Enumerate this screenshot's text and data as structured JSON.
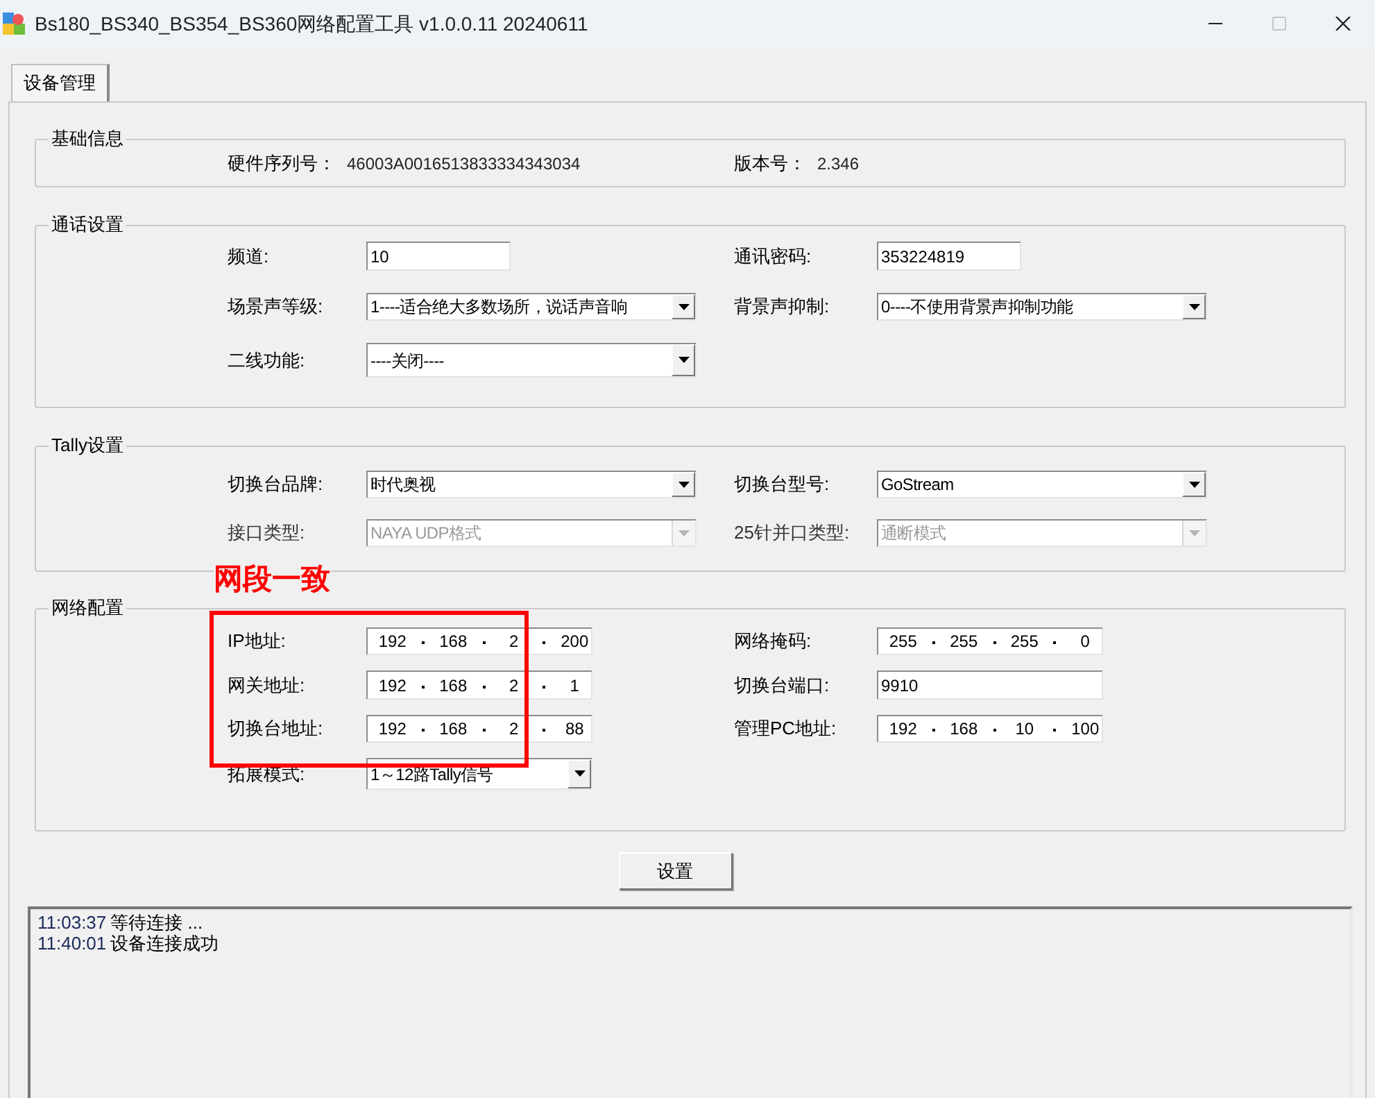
{
  "window": {
    "title": "Bs180_BS340_BS354_BS360网络配置工具 v1.0.0.11 20240611",
    "buttons": [
      {
        "kind": "minimize",
        "disabled": false
      },
      {
        "kind": "maximize",
        "disabled": true
      },
      {
        "kind": "close",
        "disabled": false
      }
    ]
  },
  "tabs": [
    {
      "label": "设备管理",
      "selected": true
    }
  ],
  "groups": [
    {
      "title": "基础信息",
      "rows": [
        [
          {
            "kind": "info",
            "label": "硬件序列号：",
            "value": "46003A0016513833334343034"
          },
          {
            "kind": "info",
            "label": "版本号：",
            "value": "2.346"
          }
        ]
      ]
    },
    {
      "title": "通话设置",
      "rows": [
        [
          {
            "kind": "text",
            "label": "频道:",
            "value": "10"
          },
          {
            "kind": "text",
            "label": "通讯密码:",
            "value": "353224819"
          }
        ],
        [
          {
            "kind": "combo",
            "label": "场景声等级:",
            "value": "1----适合绝大多数场所，说话声音响",
            "disabled": false
          },
          {
            "kind": "combo",
            "label": "背景声抑制:",
            "value": "0----不使用背景声抑制功能",
            "disabled": false
          }
        ],
        [
          {
            "kind": "combo",
            "label": "二线功能:",
            "value": "----关闭----",
            "disabled": false
          }
        ]
      ]
    },
    {
      "title": "Tally设置",
      "rows": [
        [
          {
            "kind": "combo",
            "label": "切换台品牌:",
            "value": "时代奥视",
            "disabled": false
          },
          {
            "kind": "combo",
            "label": "切换台型号:",
            "value": "GoStream",
            "disabled": false
          }
        ],
        [
          {
            "kind": "combo",
            "label": "接口类型:",
            "value": "NAYA UDP格式",
            "disabled": true
          },
          {
            "kind": "combo",
            "label": "25针并口类型:",
            "value": "通断模式",
            "disabled": true
          }
        ]
      ]
    },
    {
      "title": "网络配置",
      "annotation": "网段一致",
      "rows": [
        [
          {
            "kind": "ip",
            "label": "IP地址:",
            "octets": [
              "192",
              "168",
              "2",
              "200"
            ]
          },
          {
            "kind": "ip",
            "label": "网络掩码:",
            "octets": [
              "255",
              "255",
              "255",
              "0"
            ]
          }
        ],
        [
          {
            "kind": "ip",
            "label": "网关地址:",
            "octets": [
              "192",
              "168",
              "2",
              "1"
            ]
          },
          {
            "kind": "text",
            "label": "切换台端口:",
            "value": "9910"
          }
        ],
        [
          {
            "kind": "ip",
            "label": "切换台地址:",
            "octets": [
              "192",
              "168",
              "2",
              "88"
            ]
          },
          {
            "kind": "ip",
            "label": "管理PC地址:",
            "octets": [
              "192",
              "168",
              "10",
              "100"
            ]
          }
        ],
        [
          {
            "kind": "combo",
            "label": "拓展模式:",
            "value": "1～12路Tally信号",
            "disabled": false
          }
        ]
      ]
    }
  ],
  "set_button": "设置",
  "log": [
    {
      "time": "11:03:37",
      "message": "等待连接 ..."
    },
    {
      "time": "11:40:01",
      "message": "设备连接成功"
    }
  ]
}
